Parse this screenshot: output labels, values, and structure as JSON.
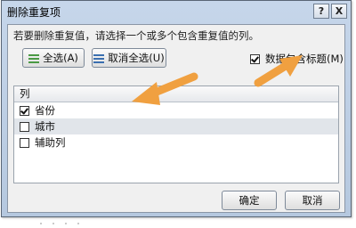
{
  "window": {
    "title": "删除重复项",
    "help_label": "?",
    "close_label": "X"
  },
  "instruction": "若要删除重复值，请选择一个或多个包含重复值的列。",
  "buttons": {
    "select_all": "全选(A)",
    "deselect_all": "取消全选(U)",
    "ok": "确定",
    "cancel": "取消"
  },
  "header_option": {
    "label": "数据包含标题(M)",
    "checked": true
  },
  "list": {
    "header": "列",
    "items": [
      {
        "label": "省份",
        "checked": true
      },
      {
        "label": "城市",
        "checked": false
      },
      {
        "label": "辅助列",
        "checked": false
      }
    ]
  },
  "annotations": {
    "arrow_color": "#f0a040"
  },
  "icons": [
    "checklist-icon",
    "uncheck-list-icon",
    "help-icon",
    "close-icon",
    "annotation-arrow-icon"
  ]
}
